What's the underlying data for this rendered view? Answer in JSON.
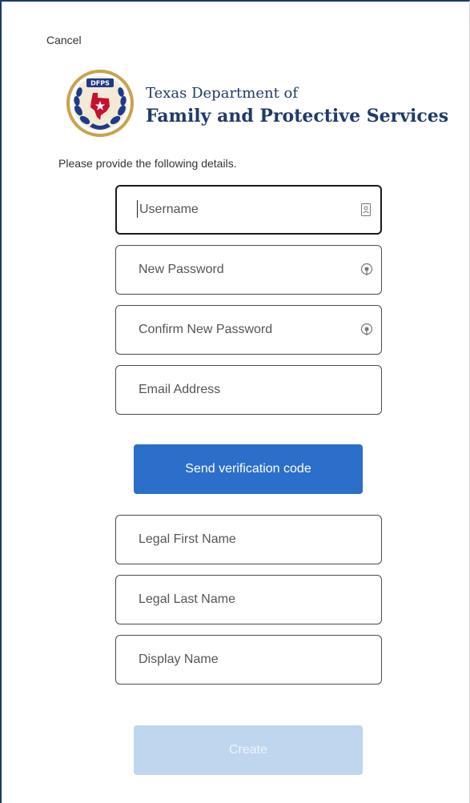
{
  "header": {
    "cancel_label": "Cancel"
  },
  "logo": {
    "seal_text": "DFPS",
    "line1": "Texas Department of",
    "line2": "Family and Protective Services"
  },
  "instructions": "Please provide the following details.",
  "fields": {
    "username": {
      "placeholder": "Username",
      "value": "",
      "icon": "contact-card-icon",
      "focused": true
    },
    "new_password": {
      "placeholder": "New Password",
      "value": "",
      "icon": "password-reveal-icon"
    },
    "confirm_password": {
      "placeholder": "Confirm New Password",
      "value": "",
      "icon": "password-reveal-icon"
    },
    "email": {
      "placeholder": "Email Address",
      "value": ""
    },
    "first_name": {
      "placeholder": "Legal First Name",
      "value": ""
    },
    "last_name": {
      "placeholder": "Legal Last Name",
      "value": ""
    },
    "display_name": {
      "placeholder": "Display Name",
      "value": ""
    }
  },
  "buttons": {
    "send_code_label": "Send verification code",
    "create_label": "Create"
  },
  "colors": {
    "brand_navy": "#1f3a6b",
    "primary_button": "#2b6fca",
    "disabled_button": "#bfd6ef",
    "seal_red": "#c8102e",
    "seal_gold": "#c9a24a",
    "seal_blue": "#1f3a8a"
  }
}
